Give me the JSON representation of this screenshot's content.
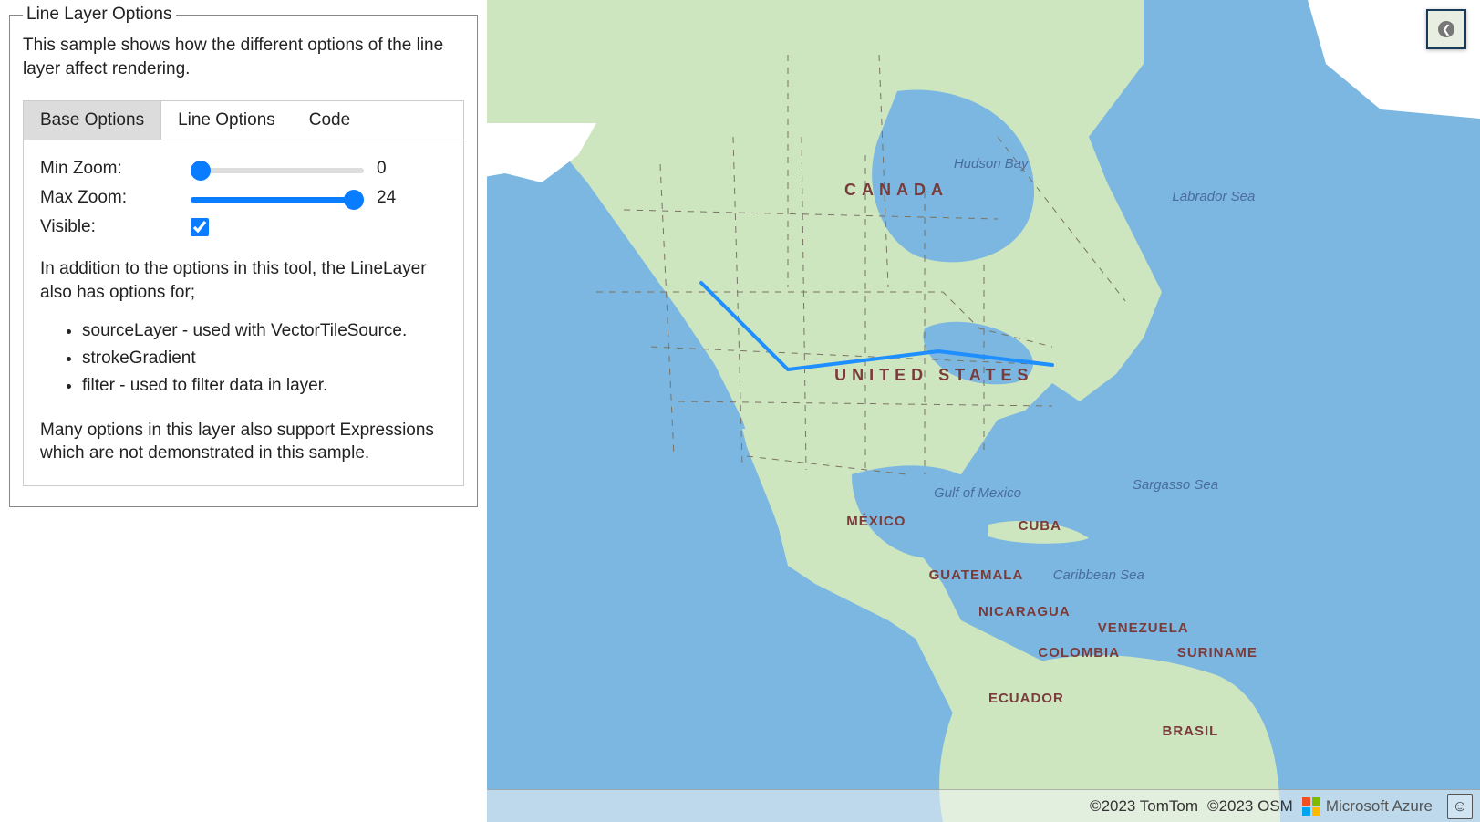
{
  "panel": {
    "legend": "Line Layer Options",
    "intro": "This sample shows how the different options of the line layer affect rendering.",
    "tabs": {
      "base": "Base Options",
      "line": "Line Options",
      "code": "Code",
      "active": "base"
    },
    "controls": {
      "minZoom": {
        "label": "Min Zoom:",
        "value": 0,
        "min": 0,
        "max": 24
      },
      "maxZoom": {
        "label": "Max Zoom:",
        "value": 24,
        "min": 0,
        "max": 24
      },
      "visible": {
        "label": "Visible:",
        "checked": true
      }
    },
    "notes": {
      "lead": "In addition to the options in this tool, the LineLayer also has options for;",
      "items": [
        "sourceLayer - used with VectorTileSource.",
        "strokeGradient",
        "filter - used to filter data in layer."
      ],
      "trail": "Many options in this layer also support Expressions which are not demonstrated in this sample."
    }
  },
  "map": {
    "colors": {
      "water": "#7bb7e0",
      "land": "#cde6c0",
      "landPale": "#e7ecd6",
      "ice": "#ffffff",
      "route": "#1f8fff",
      "subdivision": "#7a7365",
      "countryLabel": "#7a3b3b",
      "seaLabel": "#4a6d9c"
    },
    "labels": {
      "countries": [
        {
          "text": "CANADA",
          "x_pct": 36.0,
          "y_pct": 22.0,
          "wide": true
        },
        {
          "text": "UNITED STATES",
          "x_pct": 35.0,
          "y_pct": 44.5,
          "wide": true
        },
        {
          "text": "MÉXICO",
          "x_pct": 36.2,
          "y_pct": 62.5
        },
        {
          "text": "CUBA",
          "x_pct": 53.5,
          "y_pct": 63.0
        },
        {
          "text": "GUATEMALA",
          "x_pct": 44.5,
          "y_pct": 69.0
        },
        {
          "text": "NICARAGUA",
          "x_pct": 49.5,
          "y_pct": 73.5
        },
        {
          "text": "VENEZUELA",
          "x_pct": 61.5,
          "y_pct": 75.5
        },
        {
          "text": "COLOMBIA",
          "x_pct": 55.5,
          "y_pct": 78.5
        },
        {
          "text": "SURINAME",
          "x_pct": 69.5,
          "y_pct": 78.5
        },
        {
          "text": "ECUADOR",
          "x_pct": 50.5,
          "y_pct": 84.0
        },
        {
          "text": "BRASIL",
          "x_pct": 68.0,
          "y_pct": 88.0
        }
      ],
      "seas": [
        {
          "text": "Hudson Bay",
          "x_pct": 47.0,
          "y_pct": 19.0
        },
        {
          "text": "Labrador Sea",
          "x_pct": 69.0,
          "y_pct": 23.0
        },
        {
          "text": "Gulf of Mexico",
          "x_pct": 45.0,
          "y_pct": 59.0
        },
        {
          "text": "Sargasso Sea",
          "x_pct": 65.0,
          "y_pct": 58.0
        },
        {
          "text": "Caribbean Sea",
          "x_pct": 57.0,
          "y_pct": 69.0
        }
      ]
    },
    "attribution": {
      "tomtom": "©2023 TomTom",
      "osm": "©2023 OSM",
      "brand": "Microsoft Azure"
    }
  }
}
